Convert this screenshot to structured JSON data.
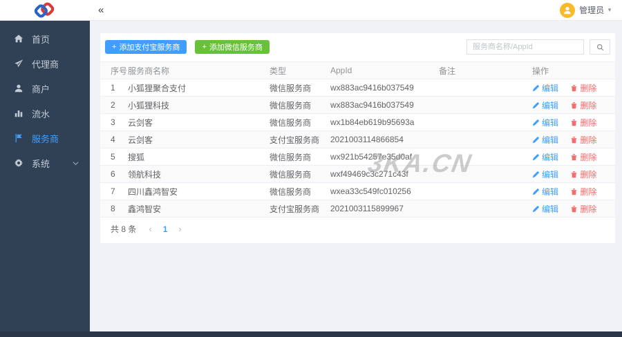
{
  "header": {
    "collapse_glyph": "«",
    "user": {
      "name": "管理员",
      "caret": "▼"
    }
  },
  "sidebar": {
    "items": [
      {
        "key": "home",
        "label": "首页",
        "icon": "home-icon",
        "active": false,
        "has_children": false
      },
      {
        "key": "agent",
        "label": "代理商",
        "icon": "send-icon",
        "active": false,
        "has_children": false
      },
      {
        "key": "merchant",
        "label": "商户",
        "icon": "user-icon",
        "active": false,
        "has_children": false
      },
      {
        "key": "flow",
        "label": "流水",
        "icon": "chart-icon",
        "active": false,
        "has_children": false
      },
      {
        "key": "provider",
        "label": "服务商",
        "icon": "flag-icon",
        "active": true,
        "has_children": false
      },
      {
        "key": "system",
        "label": "系统",
        "icon": "gear-icon",
        "active": false,
        "has_children": true
      }
    ]
  },
  "toolbar": {
    "add_alipay": {
      "plus_glyph": "+",
      "label": "添加支付宝服务商"
    },
    "add_wechat": {
      "plus_glyph": "+",
      "label": "添加微信服务商"
    },
    "search": {
      "placeholder": "服务商名称/AppId",
      "icon": "search-icon"
    }
  },
  "table": {
    "columns": [
      "序号",
      "服务商名称",
      "类型",
      "AppId",
      "备注",
      "操作"
    ],
    "edit_label": "编辑",
    "delete_label": "删除",
    "rows": [
      {
        "no": "1",
        "name": "小狐狸聚合支付",
        "type": "微信服务商",
        "appid": "wx883ac9416b037549",
        "remark": ""
      },
      {
        "no": "2",
        "name": "小狐狸科技",
        "type": "微信服务商",
        "appid": "wx883ac9416b037549",
        "remark": ""
      },
      {
        "no": "3",
        "name": "云剑客",
        "type": "微信服务商",
        "appid": "wx1b84eb619b95693a",
        "remark": ""
      },
      {
        "no": "4",
        "name": "云剑客",
        "type": "支付宝服务商",
        "appid": "2021003114866854",
        "remark": ""
      },
      {
        "no": "5",
        "name": "搜狐",
        "type": "微信服务商",
        "appid": "wx921b54257e35d0af",
        "remark": ""
      },
      {
        "no": "6",
        "name": "领航科技",
        "type": "微信服务商",
        "appid": "wxf49469c3c271c43f",
        "remark": ""
      },
      {
        "no": "7",
        "name": "四川鑫鸿智安",
        "type": "微信服务商",
        "appid": "wxea33c549fc010256",
        "remark": ""
      },
      {
        "no": "8",
        "name": "鑫鸿智安",
        "type": "支付宝服务商",
        "appid": "2021003115899967",
        "remark": ""
      }
    ]
  },
  "pagination": {
    "total_text": "共 8 条",
    "prev": "‹",
    "page": "1",
    "next": "›"
  },
  "watermark": "3KA.CN",
  "colors": {
    "accent_blue": "#409eff",
    "success_green": "#67c23a",
    "danger_red": "#f56c6c",
    "sidebar_bg": "#304156",
    "avatar_yellow": "#f7ba2a",
    "logo_blue": "#2a63c5",
    "logo_red": "#d63c3c"
  }
}
